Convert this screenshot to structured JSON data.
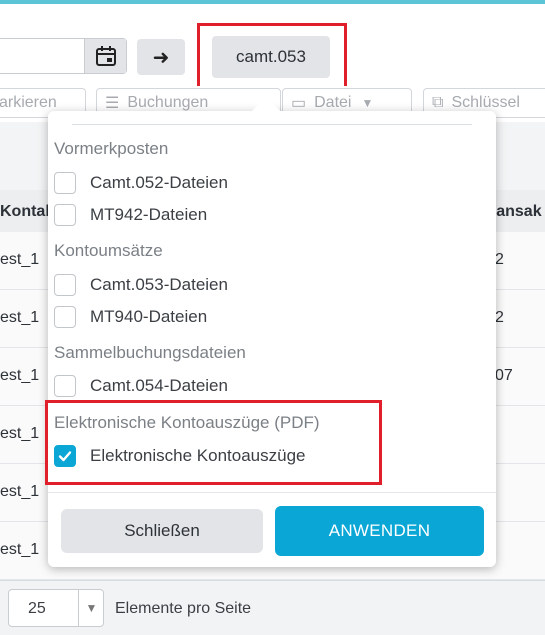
{
  "toolbar": {
    "camt_button": "camt.053",
    "go_icon": "arrow-right-icon",
    "calendar_icon": "calendar-icon"
  },
  "tabs": [
    {
      "label": "arkieren",
      "icon": ""
    },
    {
      "label": "Buchungen",
      "icon": "list-icon"
    },
    {
      "label": "Datei",
      "icon": "file-icon"
    },
    {
      "label": "Schlüssel",
      "icon": "copy-icon"
    }
  ],
  "table": {
    "headers": {
      "left": "Kontak",
      "right": "ransak"
    },
    "rows": [
      {
        "left": "est_1",
        "right": "2"
      },
      {
        "left": "est_1",
        "right": "2"
      },
      {
        "left": "est_1",
        "right": "07"
      },
      {
        "left": "est_1",
        "right": ""
      },
      {
        "left": "est_1",
        "right": ""
      },
      {
        "left": "est_1",
        "right": ""
      }
    ]
  },
  "dropdown": {
    "groups": [
      {
        "title": "Vormerkposten",
        "options": [
          {
            "label": "Camt.052-Dateien",
            "checked": false
          },
          {
            "label": "MT942-Dateien",
            "checked": false
          }
        ]
      },
      {
        "title": "Kontoumsätze",
        "options": [
          {
            "label": "Camt.053-Dateien",
            "checked": false
          },
          {
            "label": "MT940-Dateien",
            "checked": false
          }
        ]
      },
      {
        "title": "Sammelbuchungsdateien",
        "options": [
          {
            "label": "Camt.054-Dateien",
            "checked": false
          }
        ]
      },
      {
        "title": "Elektronische Kontoauszüge (PDF)",
        "options": [
          {
            "label": "Elektronische Kontoauszüge",
            "checked": true
          }
        ]
      }
    ],
    "close_label": "Schließen",
    "apply_label": "ANWENDEN"
  },
  "footer": {
    "page_size": "25",
    "page_size_label": "Elemente pro Seite"
  },
  "colors": {
    "accent": "#0aa6d6",
    "highlight": "#e01f2b",
    "top_line": "#5bc4d6"
  }
}
